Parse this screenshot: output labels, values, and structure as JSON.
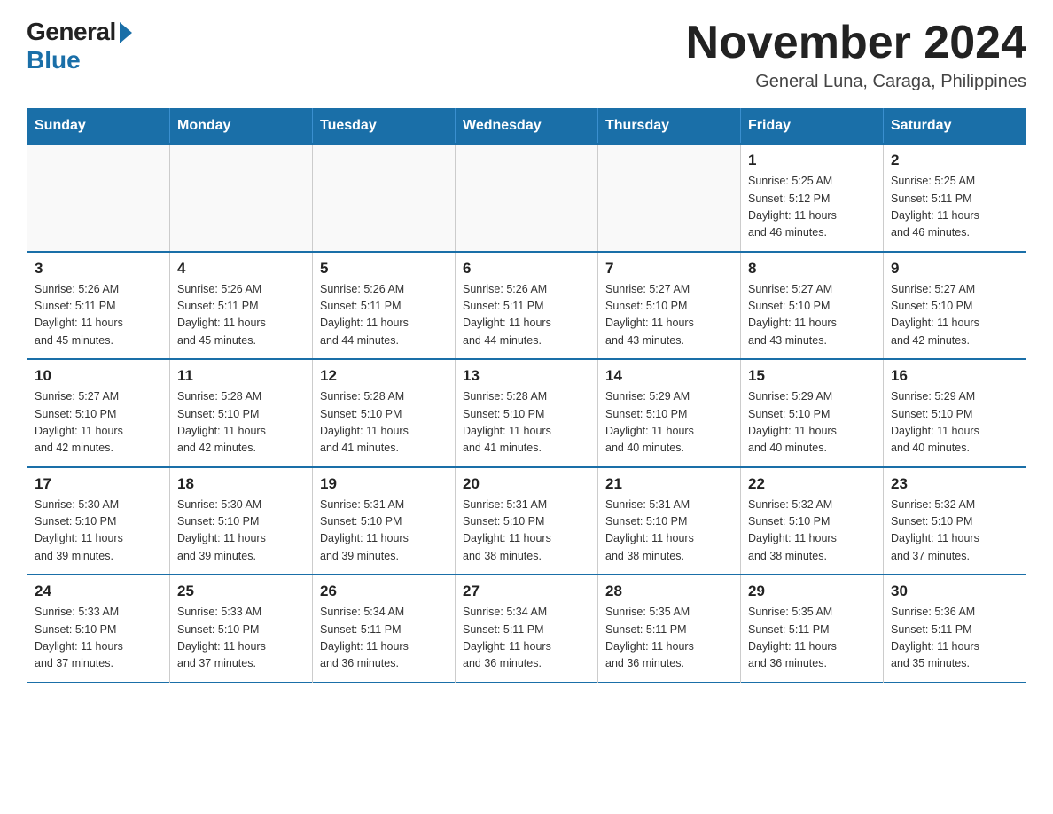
{
  "logo": {
    "general": "General",
    "blue": "Blue"
  },
  "title": "November 2024",
  "subtitle": "General Luna, Caraga, Philippines",
  "weekdays": [
    "Sunday",
    "Monday",
    "Tuesday",
    "Wednesday",
    "Thursday",
    "Friday",
    "Saturday"
  ],
  "weeks": [
    [
      {
        "day": "",
        "info": ""
      },
      {
        "day": "",
        "info": ""
      },
      {
        "day": "",
        "info": ""
      },
      {
        "day": "",
        "info": ""
      },
      {
        "day": "",
        "info": ""
      },
      {
        "day": "1",
        "info": "Sunrise: 5:25 AM\nSunset: 5:12 PM\nDaylight: 11 hours\nand 46 minutes."
      },
      {
        "day": "2",
        "info": "Sunrise: 5:25 AM\nSunset: 5:11 PM\nDaylight: 11 hours\nand 46 minutes."
      }
    ],
    [
      {
        "day": "3",
        "info": "Sunrise: 5:26 AM\nSunset: 5:11 PM\nDaylight: 11 hours\nand 45 minutes."
      },
      {
        "day": "4",
        "info": "Sunrise: 5:26 AM\nSunset: 5:11 PM\nDaylight: 11 hours\nand 45 minutes."
      },
      {
        "day": "5",
        "info": "Sunrise: 5:26 AM\nSunset: 5:11 PM\nDaylight: 11 hours\nand 44 minutes."
      },
      {
        "day": "6",
        "info": "Sunrise: 5:26 AM\nSunset: 5:11 PM\nDaylight: 11 hours\nand 44 minutes."
      },
      {
        "day": "7",
        "info": "Sunrise: 5:27 AM\nSunset: 5:10 PM\nDaylight: 11 hours\nand 43 minutes."
      },
      {
        "day": "8",
        "info": "Sunrise: 5:27 AM\nSunset: 5:10 PM\nDaylight: 11 hours\nand 43 minutes."
      },
      {
        "day": "9",
        "info": "Sunrise: 5:27 AM\nSunset: 5:10 PM\nDaylight: 11 hours\nand 42 minutes."
      }
    ],
    [
      {
        "day": "10",
        "info": "Sunrise: 5:27 AM\nSunset: 5:10 PM\nDaylight: 11 hours\nand 42 minutes."
      },
      {
        "day": "11",
        "info": "Sunrise: 5:28 AM\nSunset: 5:10 PM\nDaylight: 11 hours\nand 42 minutes."
      },
      {
        "day": "12",
        "info": "Sunrise: 5:28 AM\nSunset: 5:10 PM\nDaylight: 11 hours\nand 41 minutes."
      },
      {
        "day": "13",
        "info": "Sunrise: 5:28 AM\nSunset: 5:10 PM\nDaylight: 11 hours\nand 41 minutes."
      },
      {
        "day": "14",
        "info": "Sunrise: 5:29 AM\nSunset: 5:10 PM\nDaylight: 11 hours\nand 40 minutes."
      },
      {
        "day": "15",
        "info": "Sunrise: 5:29 AM\nSunset: 5:10 PM\nDaylight: 11 hours\nand 40 minutes."
      },
      {
        "day": "16",
        "info": "Sunrise: 5:29 AM\nSunset: 5:10 PM\nDaylight: 11 hours\nand 40 minutes."
      }
    ],
    [
      {
        "day": "17",
        "info": "Sunrise: 5:30 AM\nSunset: 5:10 PM\nDaylight: 11 hours\nand 39 minutes."
      },
      {
        "day": "18",
        "info": "Sunrise: 5:30 AM\nSunset: 5:10 PM\nDaylight: 11 hours\nand 39 minutes."
      },
      {
        "day": "19",
        "info": "Sunrise: 5:31 AM\nSunset: 5:10 PM\nDaylight: 11 hours\nand 39 minutes."
      },
      {
        "day": "20",
        "info": "Sunrise: 5:31 AM\nSunset: 5:10 PM\nDaylight: 11 hours\nand 38 minutes."
      },
      {
        "day": "21",
        "info": "Sunrise: 5:31 AM\nSunset: 5:10 PM\nDaylight: 11 hours\nand 38 minutes."
      },
      {
        "day": "22",
        "info": "Sunrise: 5:32 AM\nSunset: 5:10 PM\nDaylight: 11 hours\nand 38 minutes."
      },
      {
        "day": "23",
        "info": "Sunrise: 5:32 AM\nSunset: 5:10 PM\nDaylight: 11 hours\nand 37 minutes."
      }
    ],
    [
      {
        "day": "24",
        "info": "Sunrise: 5:33 AM\nSunset: 5:10 PM\nDaylight: 11 hours\nand 37 minutes."
      },
      {
        "day": "25",
        "info": "Sunrise: 5:33 AM\nSunset: 5:10 PM\nDaylight: 11 hours\nand 37 minutes."
      },
      {
        "day": "26",
        "info": "Sunrise: 5:34 AM\nSunset: 5:11 PM\nDaylight: 11 hours\nand 36 minutes."
      },
      {
        "day": "27",
        "info": "Sunrise: 5:34 AM\nSunset: 5:11 PM\nDaylight: 11 hours\nand 36 minutes."
      },
      {
        "day": "28",
        "info": "Sunrise: 5:35 AM\nSunset: 5:11 PM\nDaylight: 11 hours\nand 36 minutes."
      },
      {
        "day": "29",
        "info": "Sunrise: 5:35 AM\nSunset: 5:11 PM\nDaylight: 11 hours\nand 36 minutes."
      },
      {
        "day": "30",
        "info": "Sunrise: 5:36 AM\nSunset: 5:11 PM\nDaylight: 11 hours\nand 35 minutes."
      }
    ]
  ]
}
